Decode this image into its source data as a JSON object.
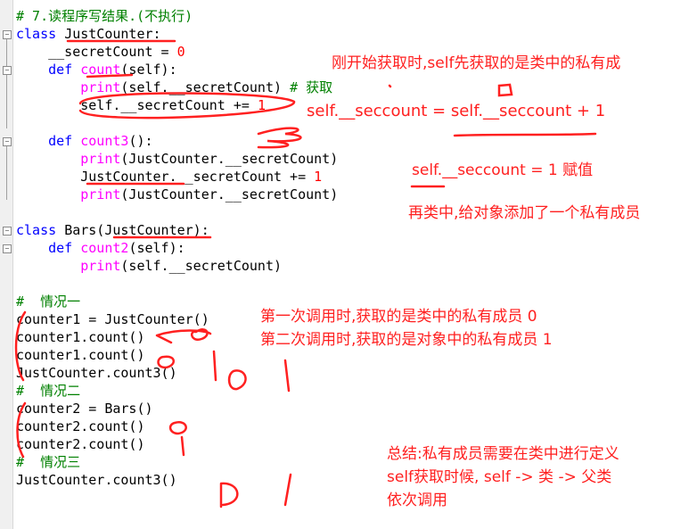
{
  "code": {
    "lines": [
      [
        {
          "t": "# 7.读程序写结果.(不执行)",
          "c": "cm"
        }
      ],
      [
        {
          "t": "class ",
          "c": "kw"
        },
        {
          "t": "JustCounter:",
          "c": "tx"
        }
      ],
      [
        {
          "t": "    __secretCount = ",
          "c": "tx"
        },
        {
          "t": "0",
          "c": "num"
        }
      ],
      [
        {
          "t": "    ",
          "c": "tx"
        },
        {
          "t": "def ",
          "c": "kw"
        },
        {
          "t": "count",
          "c": "fn"
        },
        {
          "t": "(self):",
          "c": "tx"
        }
      ],
      [
        {
          "t": "        ",
          "c": "tx"
        },
        {
          "t": "print",
          "c": "fn"
        },
        {
          "t": "(self.__secretCount) ",
          "c": "tx"
        },
        {
          "t": "# 获取",
          "c": "cm"
        }
      ],
      [
        {
          "t": "        self.__secretCount += ",
          "c": "tx"
        },
        {
          "t": "1",
          "c": "num"
        }
      ],
      [],
      [
        {
          "t": "    ",
          "c": "tx"
        },
        {
          "t": "def ",
          "c": "kw"
        },
        {
          "t": "count3",
          "c": "fn"
        },
        {
          "t": "():",
          "c": "tx"
        }
      ],
      [
        {
          "t": "        ",
          "c": "tx"
        },
        {
          "t": "print",
          "c": "fn"
        },
        {
          "t": "(JustCounter.__secretCount)",
          "c": "tx"
        }
      ],
      [
        {
          "t": "        JustCounter.__secretCount += ",
          "c": "tx"
        },
        {
          "t": "1",
          "c": "num"
        }
      ],
      [
        {
          "t": "        ",
          "c": "tx"
        },
        {
          "t": "print",
          "c": "fn"
        },
        {
          "t": "(JustCounter.__secretCount)",
          "c": "tx"
        }
      ],
      [],
      [
        {
          "t": "class ",
          "c": "kw"
        },
        {
          "t": "Bars(JustCounter):",
          "c": "tx"
        }
      ],
      [
        {
          "t": "    ",
          "c": "tx"
        },
        {
          "t": "def ",
          "c": "kw"
        },
        {
          "t": "count2",
          "c": "fn"
        },
        {
          "t": "(self):",
          "c": "tx"
        }
      ],
      [
        {
          "t": "        ",
          "c": "tx"
        },
        {
          "t": "print",
          "c": "fn"
        },
        {
          "t": "(self.__secretCount)",
          "c": "tx"
        }
      ],
      [],
      [
        {
          "t": "#  情况一",
          "c": "cm"
        }
      ],
      [
        {
          "t": "counter1 = JustCounter()",
          "c": "tx"
        }
      ],
      [
        {
          "t": "counter1.count()",
          "c": "tx"
        }
      ],
      [
        {
          "t": "counter1.count()",
          "c": "tx"
        }
      ],
      [
        {
          "t": "JustCounter.count3()",
          "c": "tx"
        }
      ],
      [
        {
          "t": "#  情况二",
          "c": "cm"
        }
      ],
      [
        {
          "t": "counter2 = Bars()",
          "c": "tx"
        }
      ],
      [
        {
          "t": "counter2.count()",
          "c": "tx"
        }
      ],
      [
        {
          "t": "counter2.count()",
          "c": "tx"
        }
      ],
      [
        {
          "t": "#  情况三",
          "c": "cm"
        }
      ],
      [
        {
          "t": "JustCounter.count3()",
          "c": "tx"
        }
      ]
    ]
  },
  "annotations": {
    "n1": "刚开始获取时,self先获取的是类中的私有成",
    "n2": "self.__seccount = self.__seccount + 1",
    "n3": "self.__seccount = 1   赋值",
    "n4": "再类中,给对象添加了一个私有成员",
    "n5": "第一次调用时,获取的是类中的私有成员    0",
    "n6": "第二次调用时,获取的是对象中的私有成员 1",
    "n7": "总结:私有成员需要在类中进行定义",
    "n8": "self获取时候,  self -> 类 -> 父类",
    "n9": "依次调用"
  },
  "colors": {
    "keyword": "#0000ff",
    "function": "#ff00ff",
    "number": "#ff0000",
    "comment": "#008000",
    "ink": "#ff2020"
  }
}
